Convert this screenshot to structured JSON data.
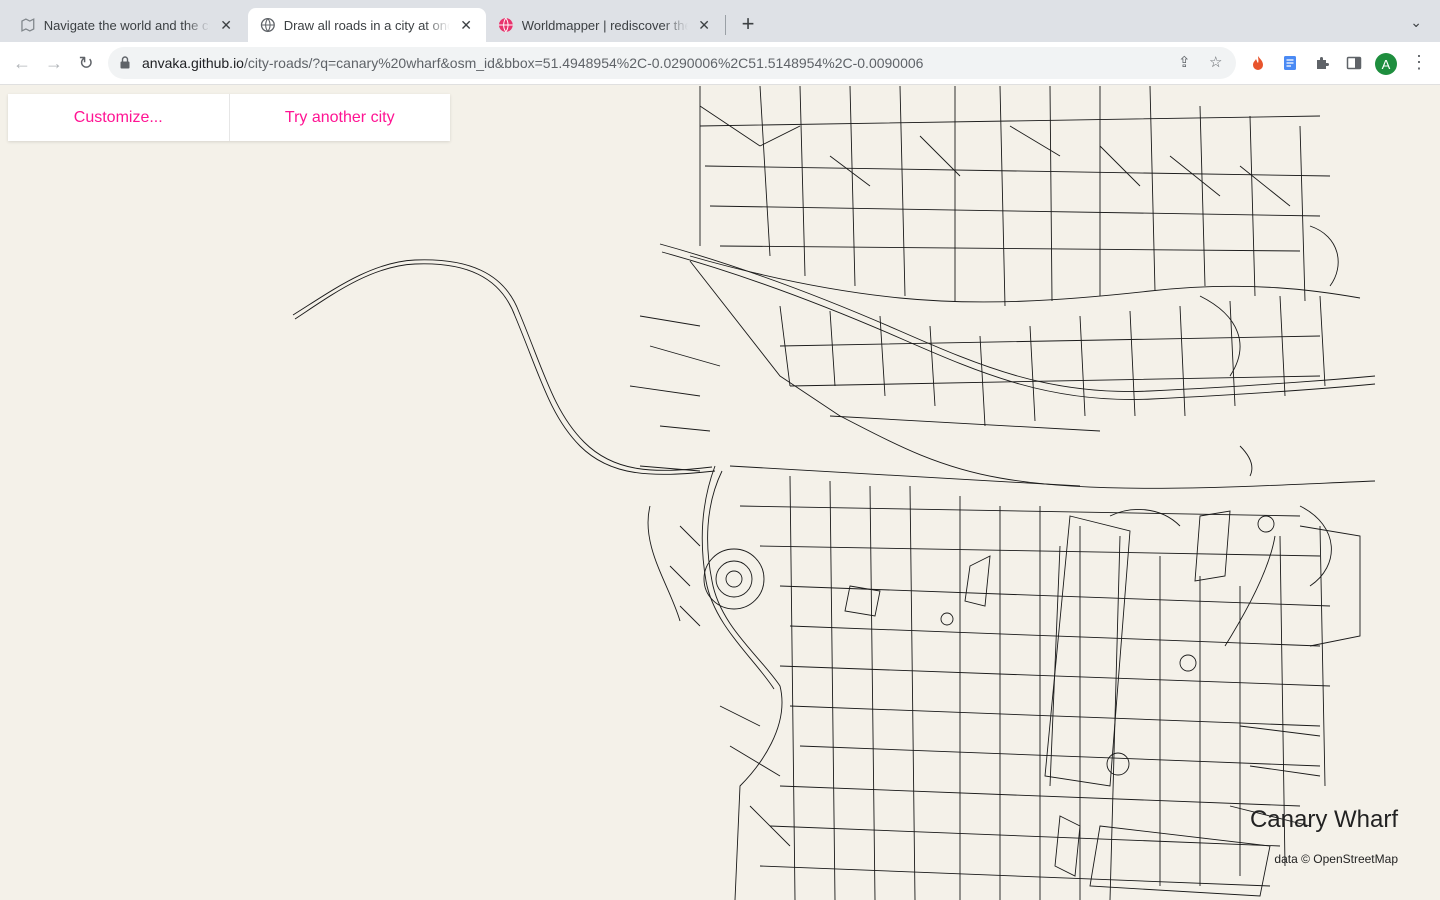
{
  "browser": {
    "tabs": [
      {
        "title": "Navigate the world and the cit",
        "icon": "map-favicon-icon"
      },
      {
        "title": "Draw all roads in a city at once",
        "icon": "globe-favicon-icon"
      },
      {
        "title": "Worldmapper | rediscover the",
        "icon": "worldmapper-favicon-icon"
      }
    ],
    "address": {
      "host": "anvaka.github.io",
      "path": "/city-roads/?q=canary%20wharf&osm_id&bbox=51.4948954%2C-0.0290006%2C51.5148954%2C-0.0090006"
    },
    "profile_initial": "A"
  },
  "page": {
    "customize_label": "Customize...",
    "another_city_label": "Try another city",
    "city_name": "Canary Wharf",
    "attribution": "data © OpenStreetMap",
    "colors": {
      "background": "#f4f1e9",
      "roads": "#1a1a1a",
      "accent": "#ff1493"
    }
  }
}
